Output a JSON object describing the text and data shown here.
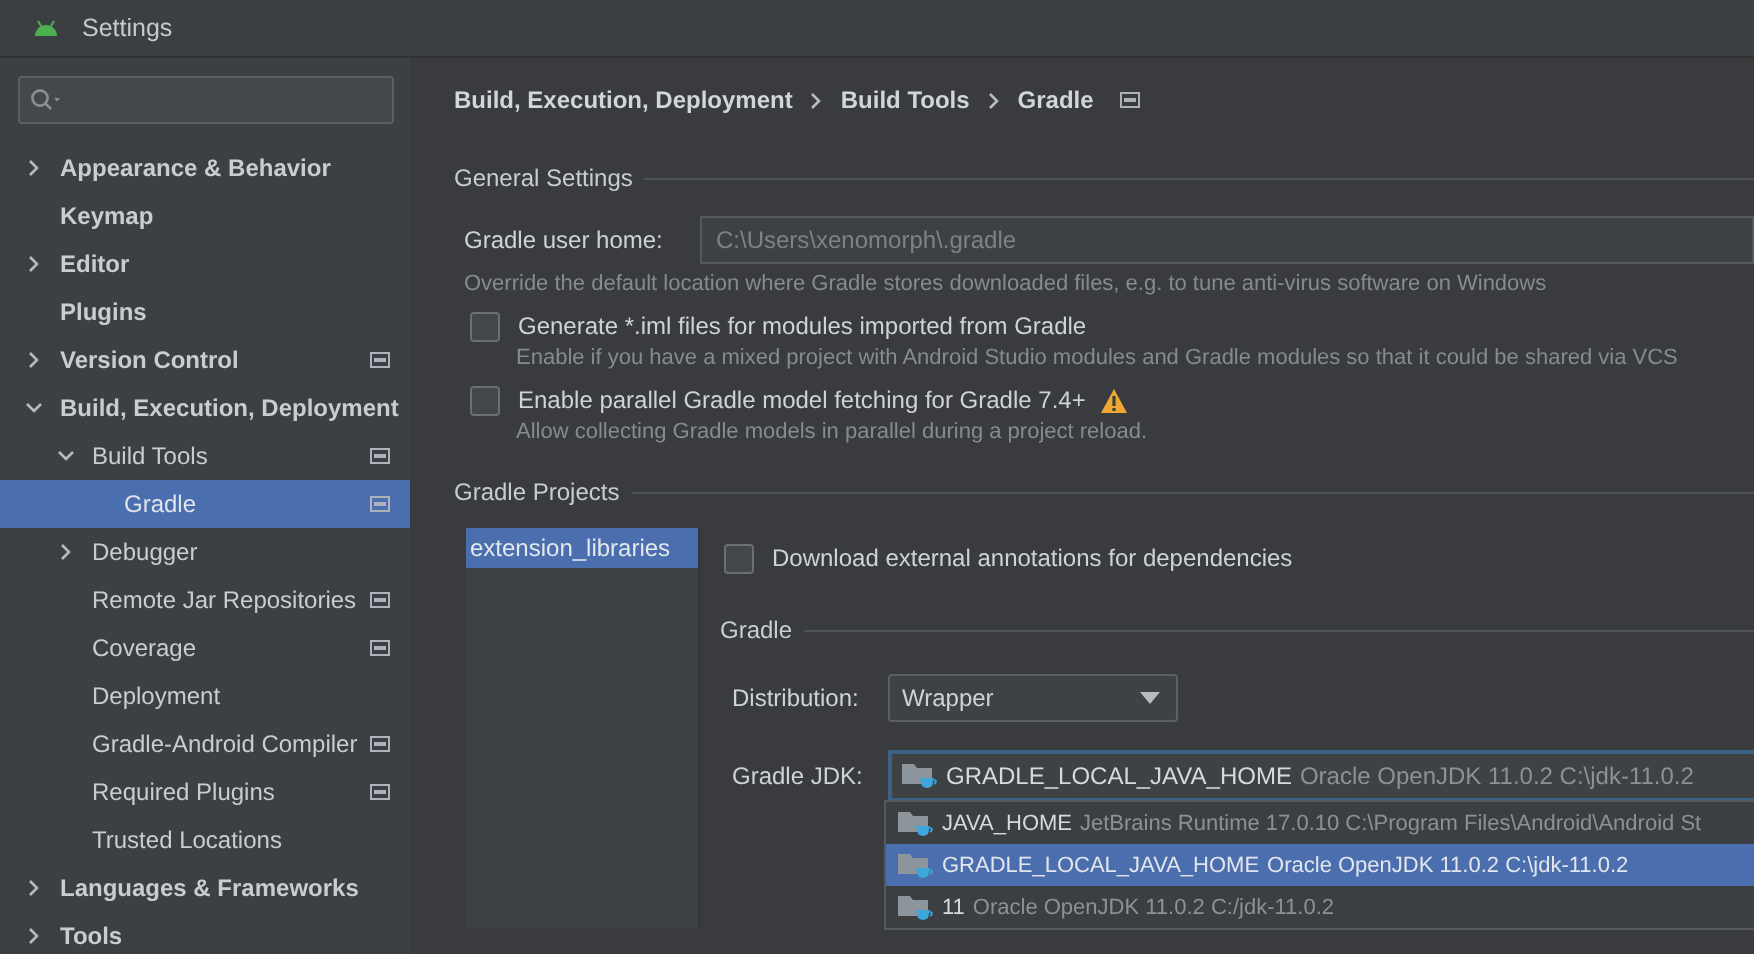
{
  "window": {
    "title": "Settings"
  },
  "sidebar": {
    "items": [
      {
        "label": "Appearance & Behavior",
        "kind": "group",
        "expanded": false,
        "selected": false,
        "project_level": false
      },
      {
        "label": "Keymap",
        "kind": "leaf",
        "selected": false,
        "project_level": false
      },
      {
        "label": "Editor",
        "kind": "group",
        "expanded": false,
        "selected": false,
        "project_level": false
      },
      {
        "label": "Plugins",
        "kind": "leaf",
        "selected": false,
        "project_level": false
      },
      {
        "label": "Version Control",
        "kind": "group",
        "expanded": false,
        "selected": false,
        "project_level": true
      },
      {
        "label": "Build, Execution, Deployment",
        "kind": "group",
        "expanded": true,
        "selected": false,
        "project_level": false,
        "children": [
          {
            "label": "Build Tools",
            "kind": "group",
            "expanded": true,
            "selected": false,
            "project_level": true,
            "children": [
              {
                "label": "Gradle",
                "kind": "leaf",
                "selected": true,
                "project_level": true
              }
            ]
          },
          {
            "label": "Debugger",
            "kind": "group",
            "expanded": false,
            "selected": false,
            "project_level": false
          },
          {
            "label": "Remote Jar Repositories",
            "kind": "leaf",
            "selected": false,
            "project_level": true
          },
          {
            "label": "Coverage",
            "kind": "leaf",
            "selected": false,
            "project_level": true
          },
          {
            "label": "Deployment",
            "kind": "leaf",
            "selected": false,
            "project_level": false
          },
          {
            "label": "Gradle-Android Compiler",
            "kind": "leaf",
            "selected": false,
            "project_level": true
          },
          {
            "label": "Required Plugins",
            "kind": "leaf",
            "selected": false,
            "project_level": true
          },
          {
            "label": "Trusted Locations",
            "kind": "leaf",
            "selected": false,
            "project_level": false
          }
        ]
      },
      {
        "label": "Languages & Frameworks",
        "kind": "group",
        "expanded": false,
        "selected": false,
        "project_level": false
      },
      {
        "label": "Tools",
        "kind": "group",
        "expanded": false,
        "selected": false,
        "project_level": false
      }
    ]
  },
  "breadcrumb": {
    "items": [
      "Build, Execution, Deployment",
      "Build Tools",
      "Gradle"
    ],
    "project_level": true
  },
  "general": {
    "title": "General Settings",
    "user_home": {
      "label": "Gradle user home:",
      "value": "C:\\Users\\xenomorph\\.gradle",
      "disabled": true
    },
    "hint": "Override the default location where Gradle stores downloaded files, e.g. to tune anti-virus software on Windows",
    "options": [
      {
        "label": "Generate *.iml files for modules imported from Gradle",
        "checked": false,
        "warning": false,
        "hint": "Enable if you have a mixed project with Android Studio modules and Gradle modules so that it could be shared via VCS"
      },
      {
        "label": "Enable parallel Gradle model fetching for Gradle 7.4+",
        "checked": false,
        "warning": true,
        "hint": "Allow collecting Gradle models in parallel during a project reload."
      }
    ]
  },
  "projects": {
    "title": "Gradle Projects",
    "list": [
      {
        "label": "extension_libraries",
        "selected": true
      }
    ],
    "download_annotations": {
      "label": "Download external annotations for dependencies",
      "checked": false
    },
    "gradle_title": "Gradle",
    "distribution": {
      "label": "Distribution:",
      "value": "Wrapper"
    },
    "jdk": {
      "label": "Gradle JDK:",
      "name": "GRADLE_LOCAL_JAVA_HOME",
      "detail": "Oracle OpenJDK 11.0.2 C:\\jdk-11.0.2"
    },
    "jdk_options": [
      {
        "name": "JAVA_HOME",
        "detail": "JetBrains Runtime 17.0.10 C:\\Program Files\\Android\\Android St",
        "selected": false
      },
      {
        "name": "GRADLE_LOCAL_JAVA_HOME",
        "detail": "Oracle OpenJDK 11.0.2 C:\\jdk-11.0.2",
        "selected": true
      },
      {
        "name": "11",
        "detail": "Oracle OpenJDK 11.0.2 C:/jdk-11.0.2",
        "selected": false
      }
    ]
  }
}
